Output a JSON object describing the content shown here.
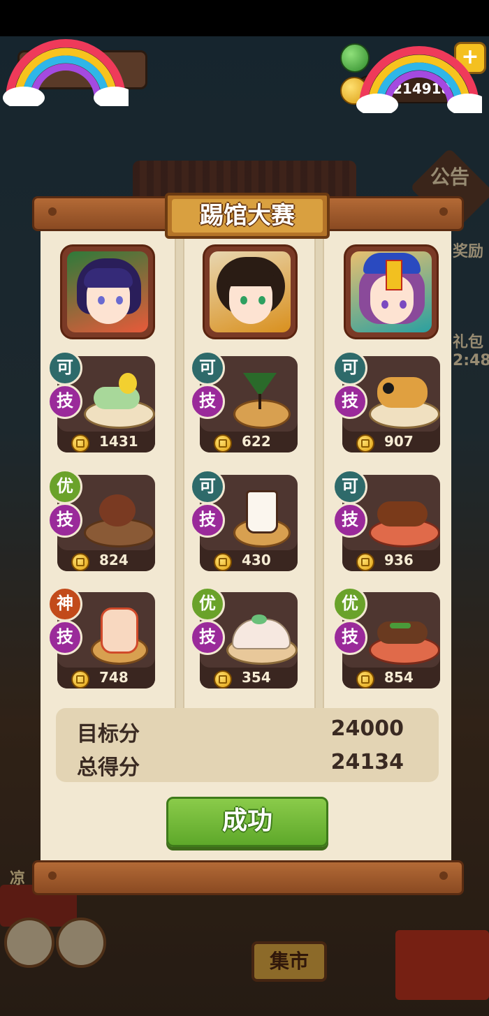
{
  "hud": {
    "coins": "214918",
    "notice_label": "公告",
    "plus": "+"
  },
  "background": {
    "market_sign": "集市",
    "side_labels": [
      "奖励",
      "礼包",
      "2:48",
      "凉"
    ]
  },
  "modal": {
    "title": "踢馆大赛",
    "columns": [
      {
        "avatar": "blue-haired-chef",
        "dishes": [
          {
            "badge": "可",
            "badge_type": "ke",
            "skill": "技",
            "price": "1431",
            "dish": "dumpling-platter"
          },
          {
            "badge": "优",
            "badge_type": "you",
            "skill": "技",
            "price": "824",
            "dish": "teapot-set"
          },
          {
            "badge": "神",
            "badge_type": "shen",
            "skill": "技",
            "price": "748",
            "dish": "fruit-jelly"
          }
        ]
      },
      {
        "avatar": "dark-haired-chef",
        "dishes": [
          {
            "badge": "可",
            "badge_type": "ke",
            "skill": "技",
            "price": "622",
            "dish": "green-cocktail"
          },
          {
            "badge": "可",
            "badge_type": "ke",
            "skill": "技",
            "price": "430",
            "dish": "milk-drink"
          },
          {
            "badge": "优",
            "badge_type": "you",
            "skill": "技",
            "price": "354",
            "dish": "steamed-buns"
          }
        ]
      },
      {
        "avatar": "jiangshi-chef",
        "dishes": [
          {
            "badge": "可",
            "badge_type": "ke",
            "skill": "技",
            "price": "907",
            "dish": "fried-platter"
          },
          {
            "badge": "可",
            "badge_type": "ke",
            "skill": "技",
            "price": "936",
            "dish": "braised-dish"
          },
          {
            "badge": "优",
            "badge_type": "you",
            "skill": "技",
            "price": "854",
            "dish": "stir-fry"
          }
        ]
      }
    ],
    "score": {
      "target_label": "目标分",
      "target_value": "24000",
      "total_label": "总得分",
      "total_value": "24134"
    },
    "result_button": "成功"
  },
  "colors": {
    "panel": "#f2e8d2",
    "card": "#4e3630",
    "title_plaque": "#d9a040",
    "button": "#6fb83a"
  }
}
